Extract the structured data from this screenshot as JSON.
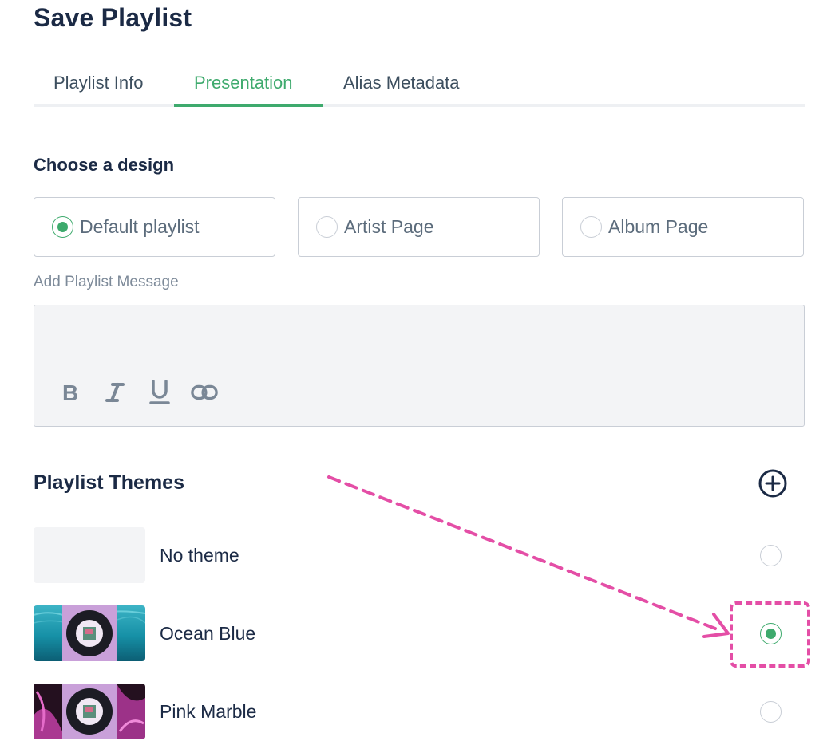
{
  "page": {
    "title": "Save Playlist"
  },
  "tabs": [
    {
      "label": "Playlist Info",
      "active": false
    },
    {
      "label": "Presentation",
      "active": true
    },
    {
      "label": "Alias Metadata",
      "active": false
    }
  ],
  "design": {
    "heading": "Choose a design",
    "options": [
      {
        "label": "Default playlist",
        "selected": true
      },
      {
        "label": "Artist Page",
        "selected": false
      },
      {
        "label": "Album Page",
        "selected": false
      }
    ]
  },
  "message": {
    "label": "Add Playlist Message",
    "value": "",
    "toolbar": [
      "bold-icon",
      "italic-icon",
      "underline-icon",
      "link-icon"
    ]
  },
  "themes": {
    "heading": "Playlist Themes",
    "add_icon": "plus-circle-icon",
    "items": [
      {
        "name": "No theme",
        "selected": false
      },
      {
        "name": "Ocean Blue",
        "selected": true
      },
      {
        "name": "Pink Marble",
        "selected": false
      }
    ]
  },
  "colors": {
    "accent": "#3eaa6d",
    "heading": "#1b2a45",
    "annotation": "#e44ea6",
    "border": "#c9ced6"
  }
}
